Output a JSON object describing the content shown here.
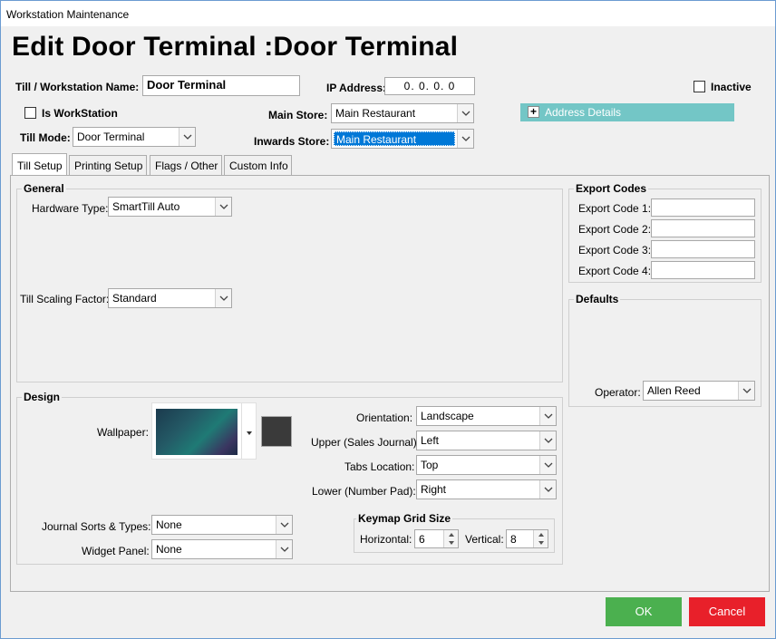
{
  "window": {
    "title": "Workstation Maintenance"
  },
  "page_title": "Edit Door Terminal :Door Terminal",
  "header": {
    "name_label": "Till / Workstation Name:",
    "name_value": "Door Terminal",
    "ip_label": "IP Address:",
    "ip_value": "0.  0.  0.  0",
    "inactive_label": "Inactive",
    "is_workstation_label": "Is WorkStation",
    "main_store_label": "Main Store:",
    "main_store_value": "Main Restaurant",
    "address_details_label": "Address Details",
    "till_mode_label": "Till Mode:",
    "till_mode_value": "Door Terminal",
    "inwards_store_label": "Inwards Store:",
    "inwards_store_value": "Main Restaurant"
  },
  "tabs": [
    {
      "label": "Till Setup",
      "active": true
    },
    {
      "label": "Printing Setup",
      "active": false
    },
    {
      "label": "Flags / Other",
      "active": false
    },
    {
      "label": "Custom Info",
      "active": false
    }
  ],
  "general": {
    "title": "General",
    "hardware_type_label": "Hardware Type:",
    "hardware_type_value": "SmartTill Auto",
    "scaling_label": "Till Scaling Factor:",
    "scaling_value": "Standard"
  },
  "export_codes": {
    "title": "Export Codes",
    "labels": [
      "Export Code 1:",
      "Export Code 2:",
      "Export Code 3:",
      "Export Code 4:"
    ],
    "values": [
      "",
      "",
      "",
      ""
    ]
  },
  "defaults": {
    "title": "Defaults",
    "operator_label": "Operator:",
    "operator_value": "Allen  Reed"
  },
  "design": {
    "title": "Design",
    "wallpaper_label": "Wallpaper:",
    "orientation_label": "Orientation:",
    "orientation_value": "Landscape",
    "upper_label": "Upper (Sales Journal):",
    "upper_value": "Left",
    "tabs_location_label": "Tabs Location:",
    "tabs_location_value": "Top",
    "lower_label": "Lower (Number Pad):",
    "lower_value": "Right",
    "journal_label": "Journal Sorts & Types:",
    "journal_value": "None",
    "widget_label": "Widget Panel:",
    "widget_value": "None",
    "keymap_title": "Keymap Grid Size",
    "horizontal_label": "Horizontal:",
    "horizontal_value": "6",
    "vertical_label": "Vertical:",
    "vertical_value": "8"
  },
  "footer": {
    "ok_label": "OK",
    "cancel_label": "Cancel"
  },
  "colors": {
    "ok": "#4bb04f",
    "cancel": "#e8202a",
    "address_bar": "#73c6c6",
    "selection": "#0078d7"
  }
}
